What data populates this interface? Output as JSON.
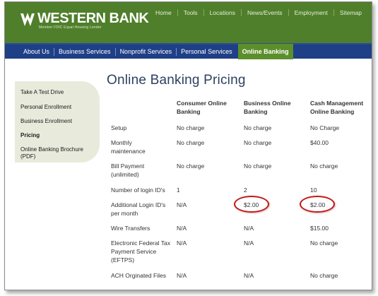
{
  "header": {
    "logo_name": "WESTERN BANK",
    "logo_sub": "Member FDIC          Equal Housing Lender",
    "top_links": [
      "Home",
      "Tools",
      "Locations",
      "News/Events",
      "Employment",
      "Sitemap"
    ]
  },
  "nav": {
    "items": [
      "About Us",
      "Business Services",
      "Nonprofit Services",
      "Personal Services"
    ],
    "active": "Online Banking"
  },
  "sidebar": {
    "items": [
      {
        "label": "Take A Test Drive",
        "active": false
      },
      {
        "label": "Personal Enrollment",
        "active": false
      },
      {
        "label": "Business Enrollment",
        "active": false
      },
      {
        "label": "Pricing",
        "active": true
      },
      {
        "label": "Online Banking Brochure (PDF)",
        "active": false
      }
    ]
  },
  "main": {
    "title": "Online Banking Pricing",
    "columns": [
      "Consumer Online Banking",
      "Business Online Banking",
      "Cash Management Online Banking"
    ],
    "rows": [
      {
        "label": "Setup",
        "values": [
          "No charge",
          "No charge",
          "No Charge"
        ]
      },
      {
        "label": "Monthly maintenance",
        "values": [
          "No charge",
          "No charge",
          "$40.00"
        ]
      },
      {
        "label": "Bill Payment (unlimited)",
        "values": [
          "No charge",
          "No charge",
          "No charge"
        ]
      },
      {
        "label": "Number of login ID's",
        "values": [
          "1",
          "2",
          "10"
        ]
      },
      {
        "label": "Additional Login ID's per month",
        "values": [
          "N/A",
          "$2.00",
          "$2.00"
        ]
      },
      {
        "label": "Wire Transfers",
        "values": [
          "N/A",
          "N/A",
          "$15.00"
        ]
      },
      {
        "label": "Electronic Federal Tax Payment Service (EFTPS)",
        "values": [
          "N/A",
          "N/A",
          "No charge"
        ]
      },
      {
        "label": "ACH Orginated Files",
        "values": [
          "N/A",
          "N/A",
          "No charge"
        ]
      }
    ]
  },
  "colors": {
    "header_green": "#4f7f2a",
    "nav_blue": "#1f3f87",
    "active_tab_green": "#5c8f2c",
    "highlight_red": "#c21a1a"
  }
}
